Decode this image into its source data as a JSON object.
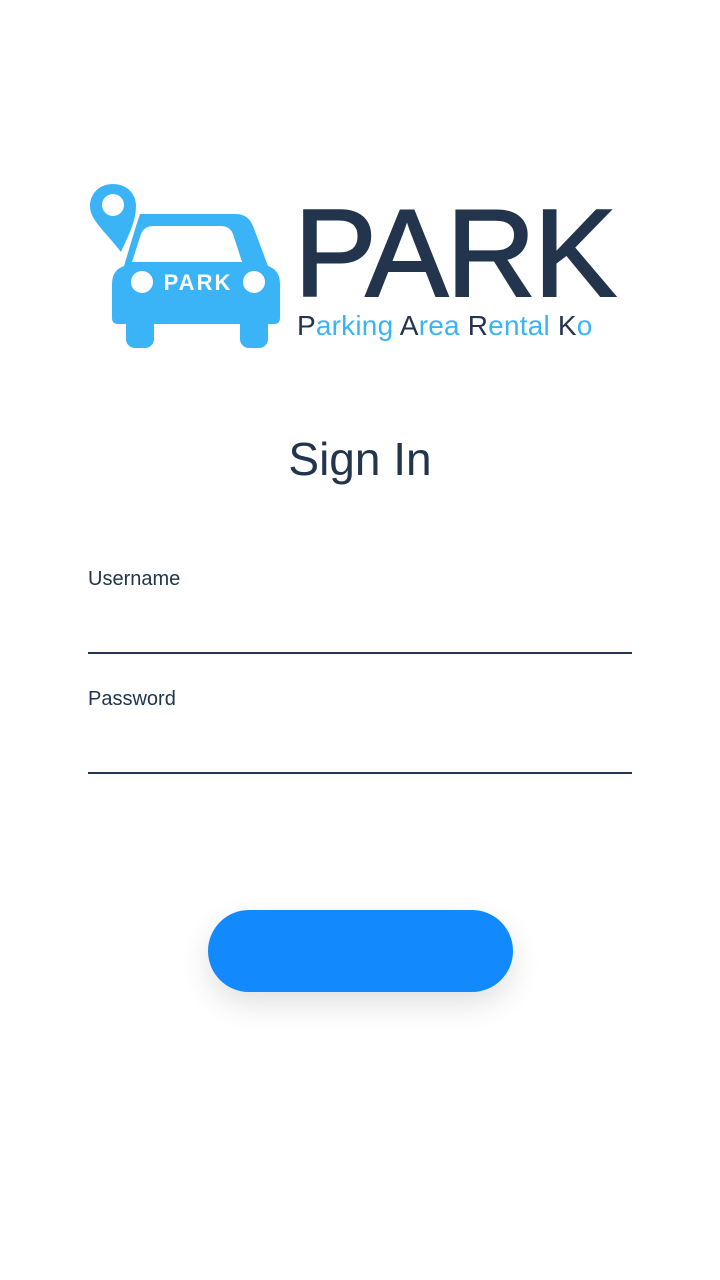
{
  "app": {
    "brand": {
      "title": "PARK",
      "car_badge": "PARK",
      "tagline_parts": [
        {
          "text": "P",
          "cap": true
        },
        {
          "text": "arking ",
          "cap": false
        },
        {
          "text": "A",
          "cap": true
        },
        {
          "text": "rea ",
          "cap": false
        },
        {
          "text": "R",
          "cap": true
        },
        {
          "text": "ental ",
          "cap": false
        },
        {
          "text": "K",
          "cap": true
        },
        {
          "text": "o",
          "cap": false
        }
      ],
      "icons": [
        "car-icon",
        "location-pin-icon"
      ]
    }
  },
  "sign_in": {
    "title": "Sign In",
    "username": {
      "label": "Username",
      "value": "",
      "placeholder": ""
    },
    "password": {
      "label": "Password",
      "value": "",
      "placeholder": ""
    },
    "submit_label": ""
  },
  "colors": {
    "primary_dark": "#22354d",
    "accent_blue": "#3bb4f7",
    "button_blue": "#1289fd",
    "background": "#ffffff"
  }
}
